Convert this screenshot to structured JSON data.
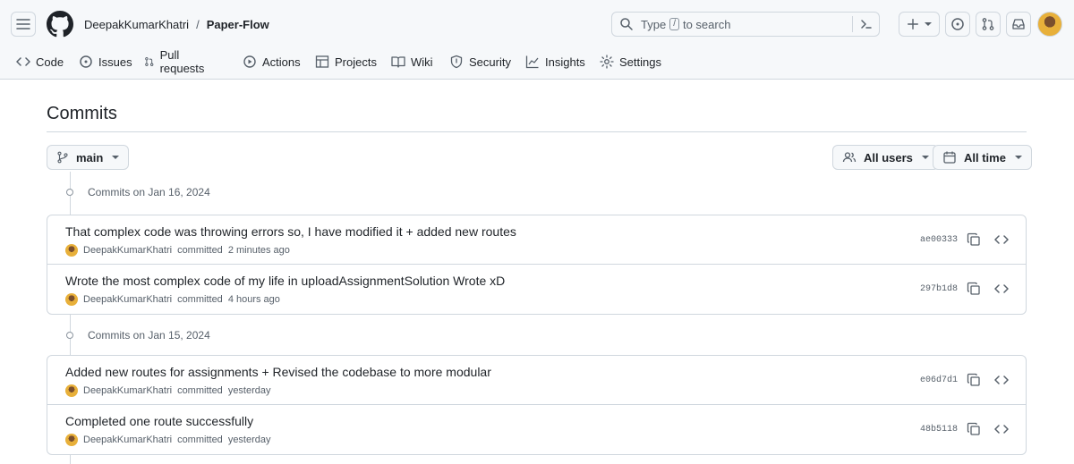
{
  "header": {
    "owner": "DeepakKumarKhatri",
    "separator": "/",
    "repo": "Paper-Flow",
    "search": {
      "placeholder_before": "Type",
      "kbd": "/",
      "placeholder_after": "to search"
    },
    "icons": [
      "hamburger-icon",
      "github-logo-icon",
      "search-icon",
      "command-palette-icon",
      "plus-icon",
      "issue-icon",
      "pull-request-icon",
      "inbox-icon",
      "avatar"
    ]
  },
  "repo_nav": {
    "tabs": [
      {
        "label": "Code",
        "icon": "code-icon"
      },
      {
        "label": "Issues",
        "icon": "issue-icon"
      },
      {
        "label": "Pull requests",
        "icon": "pull-request-icon"
      },
      {
        "label": "Actions",
        "icon": "play-icon"
      },
      {
        "label": "Projects",
        "icon": "table-icon"
      },
      {
        "label": "Wiki",
        "icon": "book-icon"
      },
      {
        "label": "Security",
        "icon": "shield-icon"
      },
      {
        "label": "Insights",
        "icon": "graph-icon"
      },
      {
        "label": "Settings",
        "icon": "gear-icon"
      }
    ]
  },
  "page": {
    "title": "Commits"
  },
  "filters": {
    "branch": "main",
    "users": "All users",
    "time": "All time"
  },
  "groups": [
    {
      "heading": "Commits on Jan 16, 2024",
      "commits": [
        {
          "message": "That complex code was throwing errors so, I have modified it + added new routes",
          "author": "DeepakKumarKhatri",
          "action": "committed",
          "when": "2 minutes ago",
          "sha": "ae00333"
        },
        {
          "message": "Wrote the most complex code of my life in uploadAssignmentSolution Wrote xD",
          "author": "DeepakKumarKhatri",
          "action": "committed",
          "when": "4 hours ago",
          "sha": "297b1d8"
        }
      ]
    },
    {
      "heading": "Commits on Jan 15, 2024",
      "commits": [
        {
          "message": "Added new routes for assignments + Revised the codebase to more modular",
          "author": "DeepakKumarKhatri",
          "action": "committed",
          "when": "yesterday",
          "sha": "e06d7d1"
        },
        {
          "message": "Completed one route successfully",
          "author": "DeepakKumarKhatri",
          "action": "committed",
          "when": "yesterday",
          "sha": "48b5118"
        }
      ]
    }
  ],
  "colors": {
    "border": "#d0d7de",
    "muted": "#57606a",
    "text": "#1f2328",
    "header_bg": "#f6f8fa"
  }
}
